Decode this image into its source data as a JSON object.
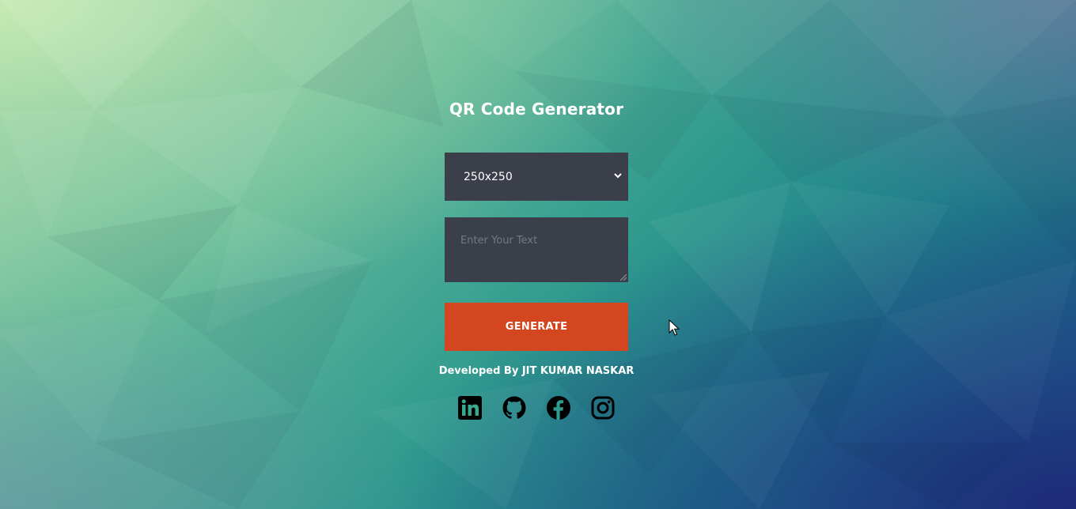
{
  "page": {
    "title": "QR Code Generator"
  },
  "form": {
    "size_select": {
      "selected": "250x250"
    },
    "text_input": {
      "placeholder": "Enter Your Text",
      "value": ""
    },
    "generate_label": "GENERATE"
  },
  "footer": {
    "credit": "Developed By JIT KUMAR NASKAR",
    "socials": [
      {
        "icon": "linkedin-icon"
      },
      {
        "icon": "github-icon"
      },
      {
        "icon": "facebook-icon"
      },
      {
        "icon": "instagram-icon"
      }
    ]
  },
  "colors": {
    "panel": "#3b3f4a",
    "accent": "#d3461f",
    "text": "#ffffff",
    "placeholder": "#737883"
  }
}
